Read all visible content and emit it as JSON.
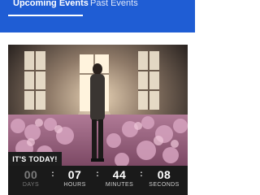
{
  "tabs": {
    "upcoming": "Upcoming Events",
    "past": "Past Events",
    "active": "upcoming"
  },
  "event": {
    "image_description_icon": "event-photo",
    "badge": "IT'S TODAY!",
    "countdown": {
      "days": {
        "value": "00",
        "label": "DAYS"
      },
      "hours": {
        "value": "07",
        "label": "HOURS"
      },
      "minutes": {
        "value": "44",
        "label": "MINUTES"
      },
      "seconds": {
        "value": "08",
        "label": "SECONDS"
      },
      "separator": ":"
    }
  },
  "colors": {
    "tab_bar": "#1f5dd4",
    "countdown_bg": "#1a1a1a",
    "card_bg": "#2a2523"
  }
}
